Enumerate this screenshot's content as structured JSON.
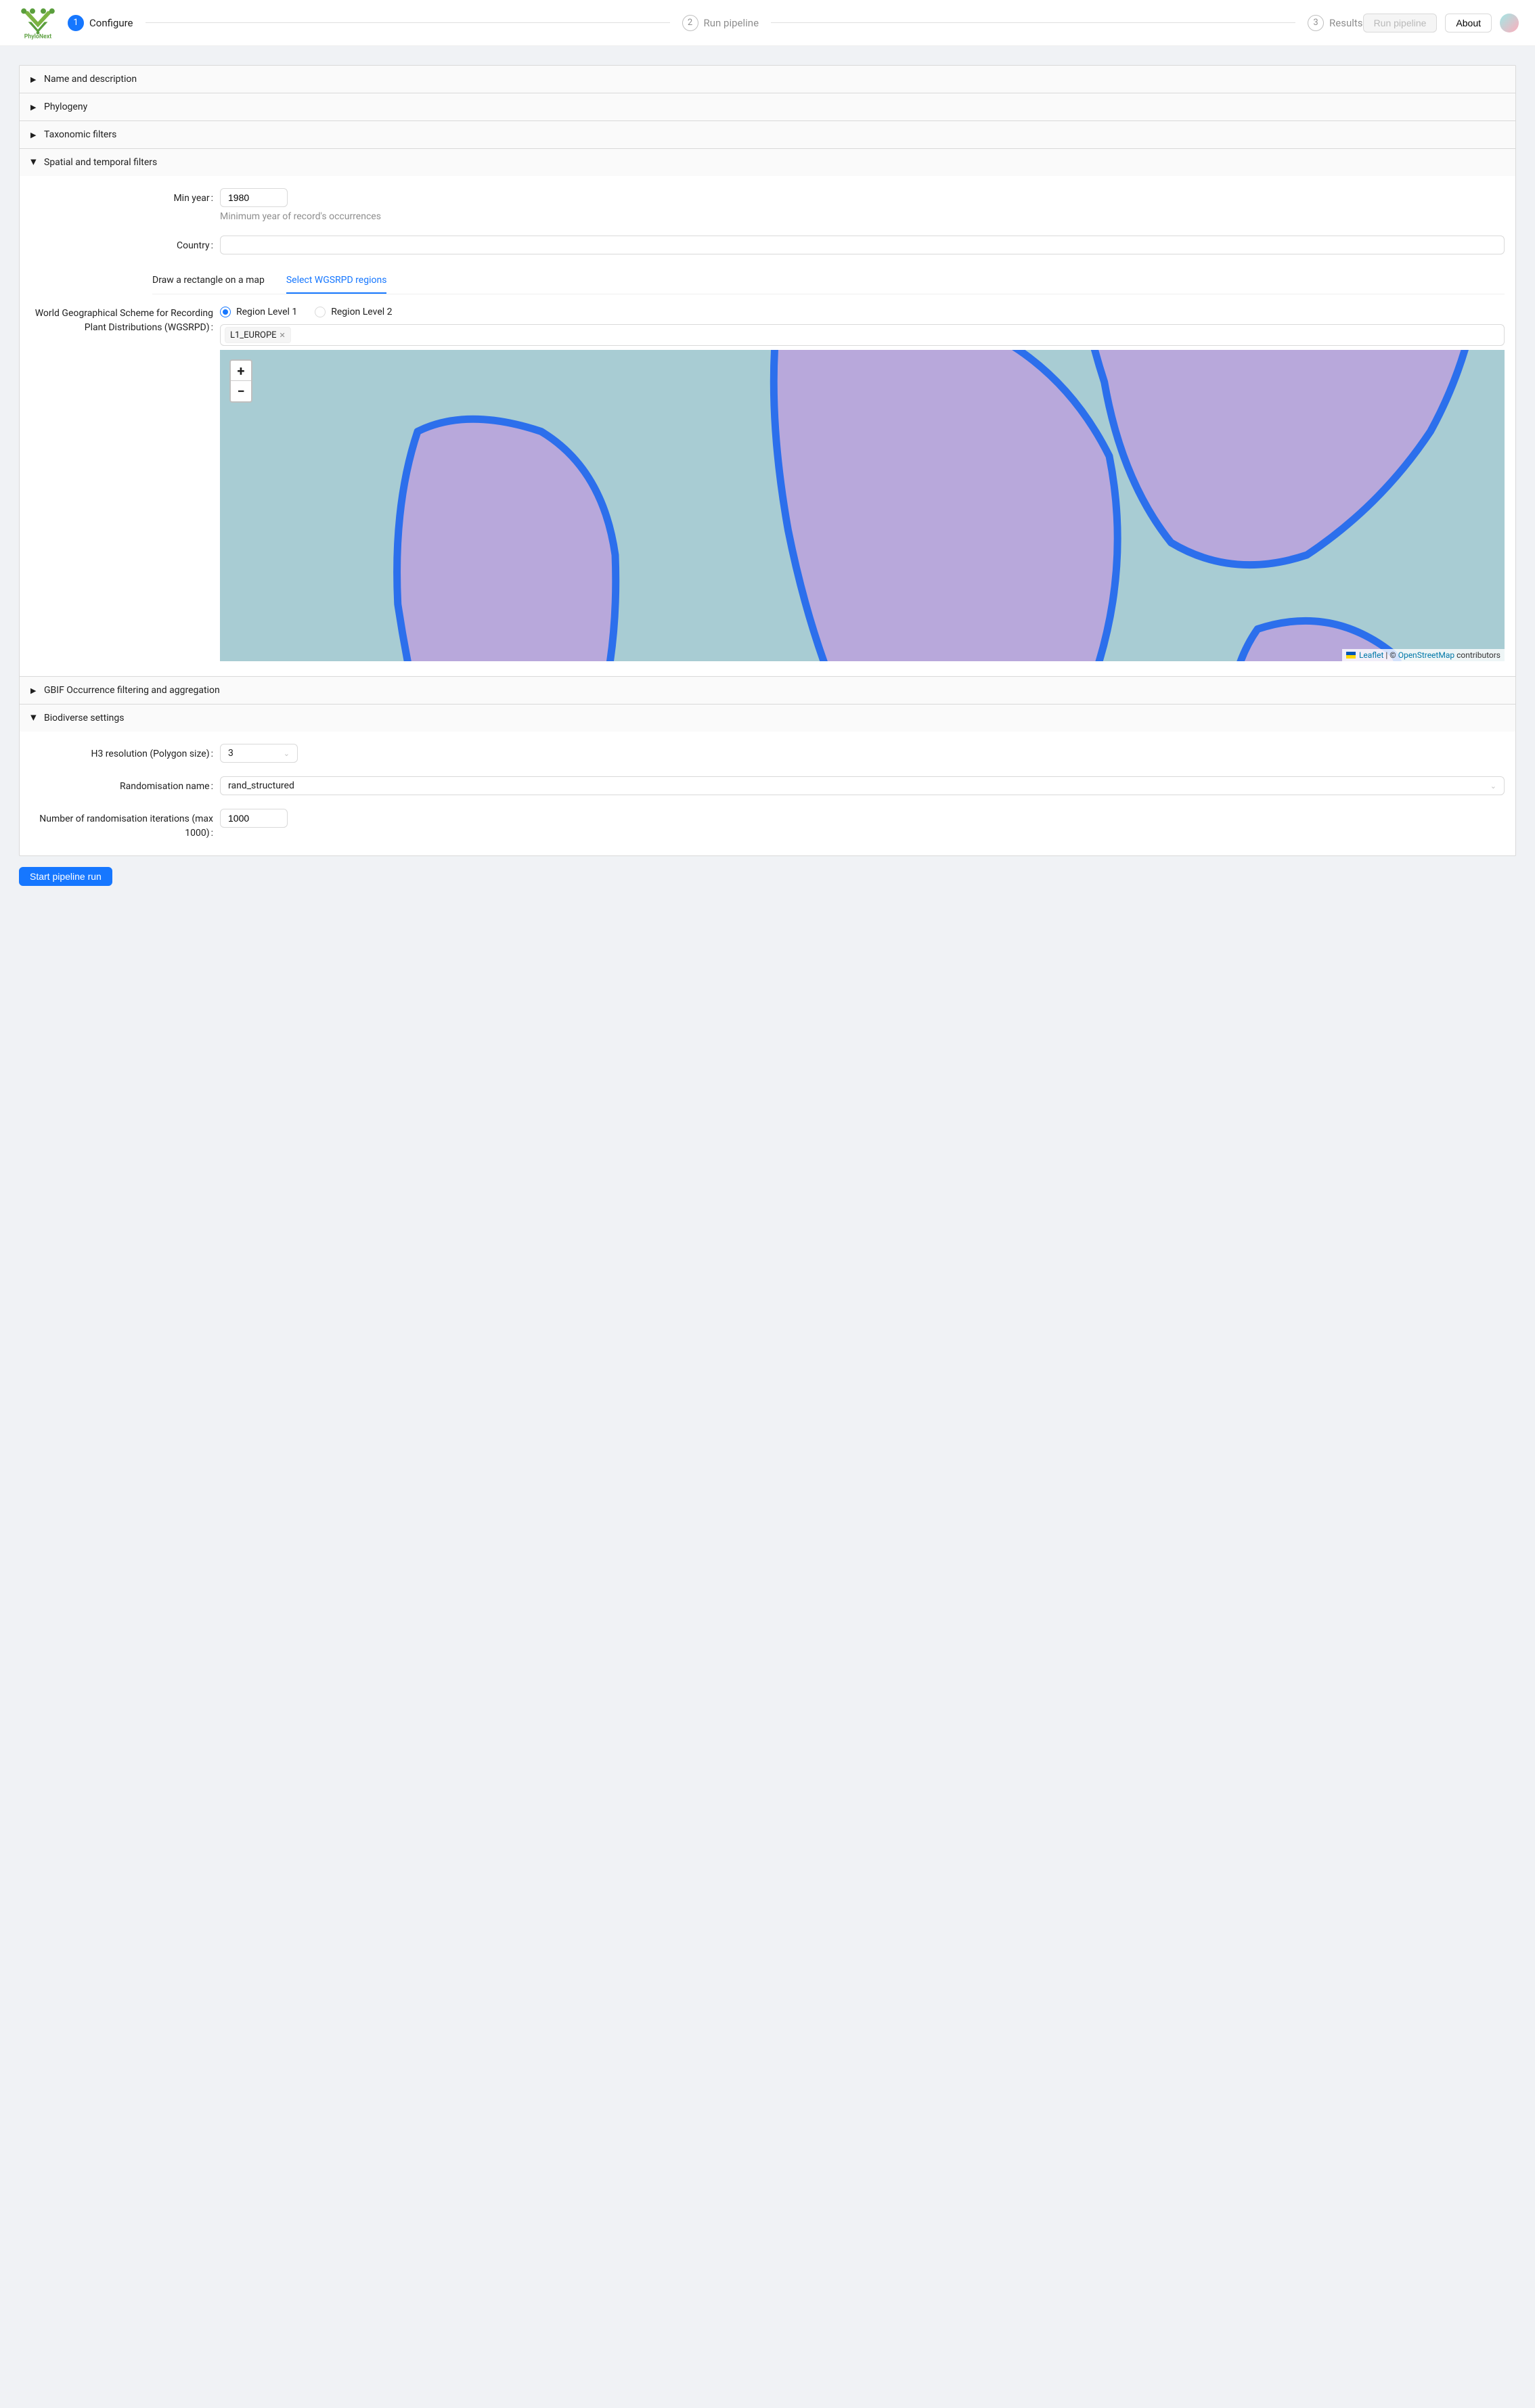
{
  "brand": "PhyloNext",
  "steps": [
    {
      "num": "1",
      "title": "Configure",
      "active": true
    },
    {
      "num": "2",
      "title": "Run pipeline",
      "active": false
    },
    {
      "num": "3",
      "title": "Results",
      "active": false
    }
  ],
  "header_buttons": {
    "run_pipeline": "Run pipeline",
    "about": "About"
  },
  "sections": {
    "name_desc": "Name and description",
    "phylogeny": "Phylogeny",
    "taxonomic": "Taxonomic filters",
    "spatial": "Spatial and temporal filters",
    "gbif": "GBIF Occurrence filtering and aggregation",
    "biodiverse": "Biodiverse settings"
  },
  "spatial": {
    "min_year_label": "Min year",
    "min_year_value": "1980",
    "min_year_help": "Minimum year of record's occurrences",
    "country_label": "Country",
    "tab_draw": "Draw a rectangle on a map",
    "tab_wgsrpd": "Select WGSRPD regions",
    "wgsrpd_label": "World Geographical Scheme for Recording Plant Distributions (WGSRPD)",
    "radio_l1": "Region Level 1",
    "radio_l2": "Region Level 2",
    "tag_value": "L1_EUROPE",
    "map": {
      "leaflet": "Leaflet",
      "osm": "OpenStreetMap",
      "contrib": " contributors",
      "copy": " | © "
    }
  },
  "biodiverse": {
    "h3_label": "H3 resolution (Polygon size)",
    "h3_value": "3",
    "rand_name_label": "Randomisation name",
    "rand_name_value": "rand_structured",
    "iter_label": "Number of randomisation iterations (max 1000)",
    "iter_value": "1000"
  },
  "start_button": "Start pipeline run"
}
